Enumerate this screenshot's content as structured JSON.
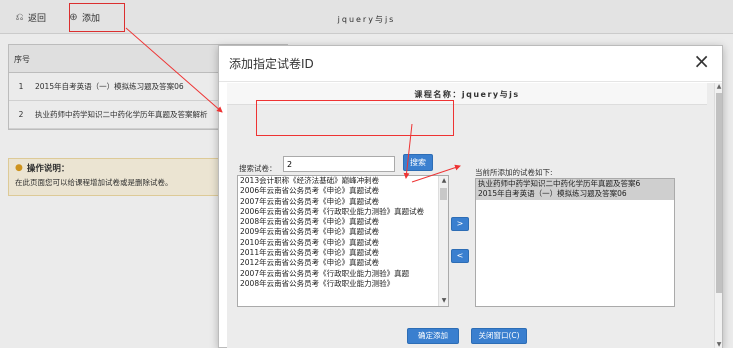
{
  "toolbar": {
    "back_label": "返回",
    "add_label": "添加",
    "title": "jquery与js"
  },
  "table": {
    "header": "序号",
    "rows": [
      {
        "num": "1",
        "text": "2015年自考英语（一）模拟练习题及答案06"
      },
      {
        "num": "2",
        "text": "执业药师中药学知识二中药化学历年真题及答案解析"
      }
    ]
  },
  "note": {
    "title": "操作说明：",
    "body": "在此页面您可以给课程增加试卷或是删除试卷。"
  },
  "modal": {
    "title": "添加指定试卷ID",
    "course_label": "课程名称：jquery与js",
    "search_label": "搜索试卷：",
    "search_value": "2",
    "search_button": "搜索",
    "right_label": "当前所添加的试卷如下:",
    "move_right": ">",
    "move_left": "<",
    "confirm_button": "确定添加",
    "close_button": "关闭窗口(C)",
    "close_icon": "×",
    "left_items": [
      "2013会计职称《经济法基础》巅峰冲刺卷",
      "2006年云南省公务员考《申论》真题试卷",
      "2007年云南省公务员考《申论》真题试卷",
      "2006年云南省公务员考《行政职业能力测验》真题试卷",
      "2008年云南省公务员考《申论》真题试卷",
      "2009年云南省公务员考《申论》真题试卷",
      "2010年云南省公务员考《申论》真题试卷",
      "2011年云南省公务员考《申论》真题试卷",
      "2012年云南省公务员考《申论》真题试卷",
      "2007年云南省公务员考《行政职业能力测验》真题",
      "2008年云南省公务员考《行政职业能力测验》"
    ],
    "right_items": [
      "执业药师中药学知识二中药化学历年真题及答案6",
      "2015年自考英语（一）模拟练习题及答案06"
    ]
  },
  "colors": {
    "accent": "#3a7fcf",
    "annotation": "#e33333"
  }
}
